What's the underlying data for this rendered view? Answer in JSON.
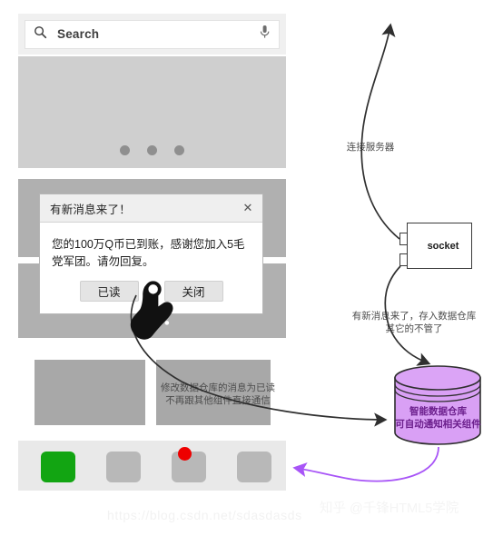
{
  "app": {
    "search": {
      "placeholder": "Search",
      "search_icon": "search-icon",
      "mic_icon": "microphone-icon"
    },
    "banner": {
      "dot_count": 3,
      "active_dot": 1
    },
    "tabbar": {
      "tabs": [
        {
          "name": "tab-1",
          "color": "#12a512",
          "active": true,
          "badge": false
        },
        {
          "name": "tab-2",
          "color": "#b8b8b8",
          "active": false,
          "badge": false
        },
        {
          "name": "tab-3",
          "color": "#b8b8b8",
          "active": false,
          "badge": true
        },
        {
          "name": "tab-4",
          "color": "#b8b8b8",
          "active": false,
          "badge": false
        }
      ],
      "badge_color": "#ee0000"
    }
  },
  "dialog": {
    "title": "有新消息来了！",
    "close_icon": "close-icon",
    "message": "您的100万Q币已到账，感谢您加入5毛党军团。请勿回复。",
    "buttons": {
      "read": "已读",
      "close": "关闭"
    },
    "cursor_icon": "hand-pointer-icon"
  },
  "diagram": {
    "socket": {
      "label": "socket",
      "port_count": 2
    },
    "database": {
      "line1": "智能数据仓库",
      "line2": "可自动通知相关组件",
      "fill": "#d9a0f5",
      "stroke": "#2f2f2f",
      "text_color": "#6b1f8c"
    },
    "notes": {
      "connect_server": "连接服务器",
      "store_message": "有新消息来了，存入数据仓库\n其它的不管了",
      "mark_read": "修改数据仓库的消息为已读\n不再跟其他组件直接通信"
    },
    "arrow_colors": {
      "flow": "#2f2f2f",
      "notify": "#a855f7"
    }
  },
  "watermarks": {
    "url": "https://blog.csdn.net/sdasdasds",
    "zhihu": "知乎 @千锋HTML5学院"
  }
}
